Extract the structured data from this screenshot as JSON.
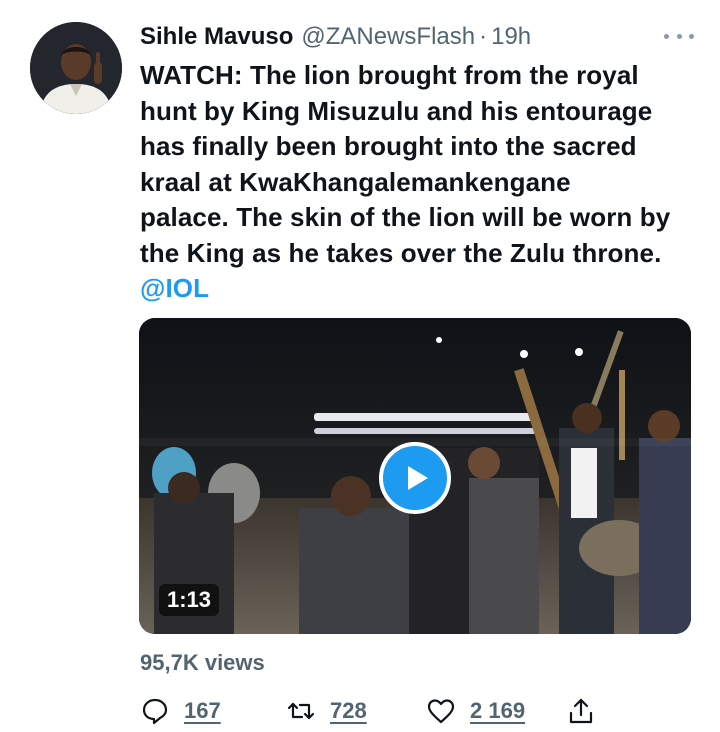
{
  "author": {
    "display_name": "Sihle Mavuso",
    "handle": "@ZANewsFlash",
    "separator": "·",
    "time": "19h",
    "avatar_icon": "profile-photo"
  },
  "tweet": {
    "lines": [
      "WATCH: The lion brought from the royal",
      "hunt by King Misuzulu and his entourage",
      "has finally been brought into the sacred",
      "kraal at KwaKhangalemankengane",
      "palace. The skin of the lion will be worn by",
      "the King as he takes over the Zulu throne."
    ],
    "mention": "@IOL"
  },
  "video": {
    "duration": "1:13",
    "play_icon": "play-icon"
  },
  "stats": {
    "views_count": "95,7K",
    "views_label": " views"
  },
  "actions": {
    "replies": "167",
    "retweets": "728",
    "likes": "2 169"
  },
  "colors": {
    "accent": "#1d9bf0",
    "text_primary": "#0f1419",
    "text_secondary": "#536471"
  }
}
